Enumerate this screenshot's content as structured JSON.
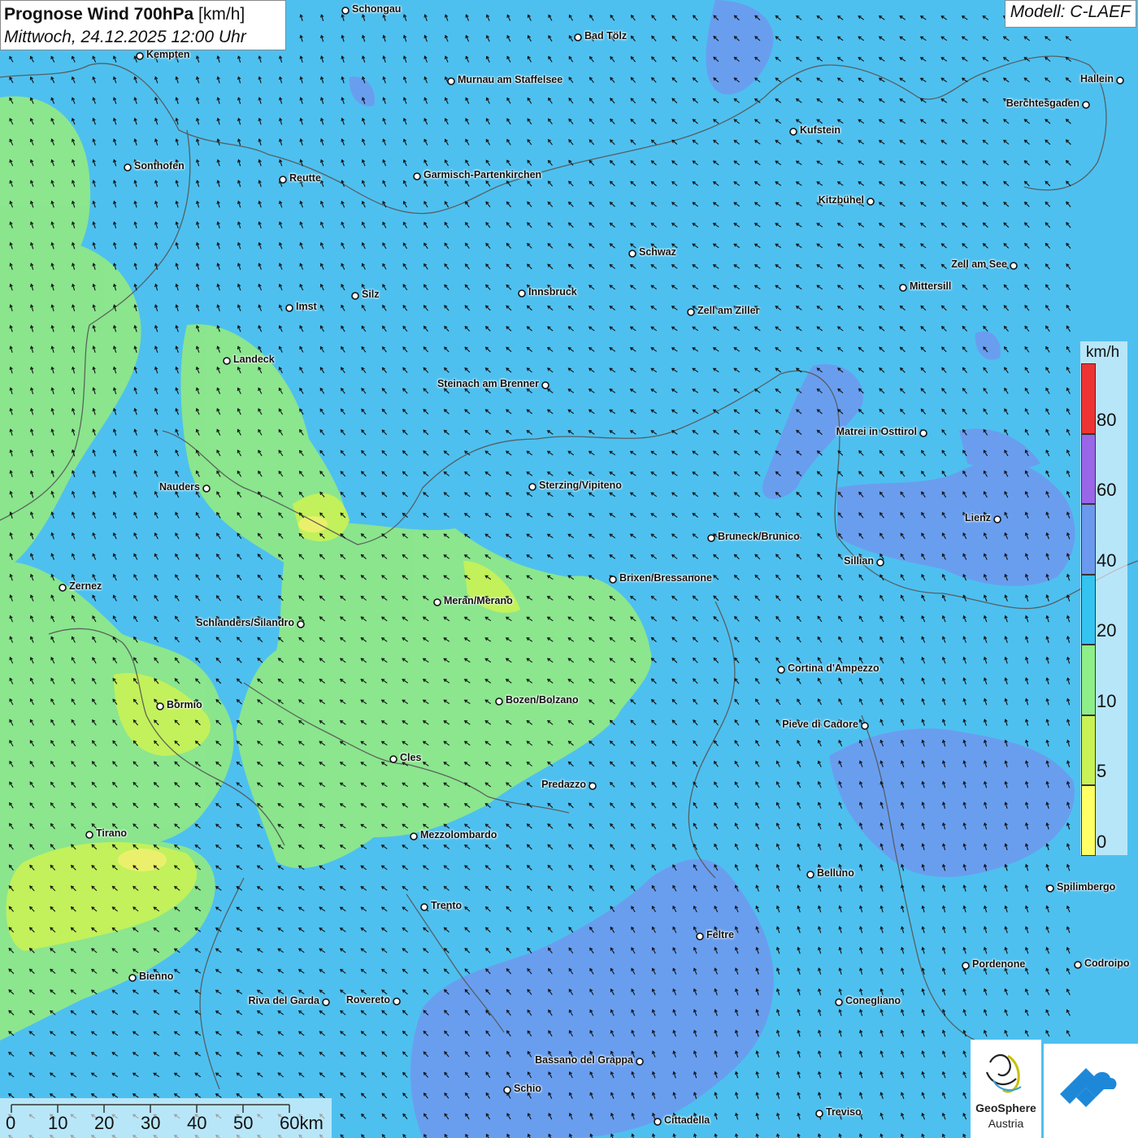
{
  "header": {
    "title_main": "Prognose Wind 700hPa",
    "title_unit": "[km/h]",
    "subtitle": "Mittwoch, 24.12.2025 12:00 Uhr",
    "model": "Modell: C-LAEF"
  },
  "legend": {
    "unit": "km/h",
    "levels": [
      {
        "label": "80",
        "color": "#ee3333"
      },
      {
        "label": "60",
        "color": "#9a66e8"
      },
      {
        "label": "40",
        "color": "#6b99ee"
      },
      {
        "label": "20",
        "color": "#35c3f0"
      },
      {
        "label": "10",
        "color": "#8eee88"
      },
      {
        "label": "5",
        "color": "#c8f255"
      },
      {
        "label": "0",
        "color": "#ffff66"
      }
    ]
  },
  "scalebar": {
    "labels": [
      "0",
      "10",
      "20",
      "30",
      "40",
      "50",
      "60km"
    ]
  },
  "cities": [
    "Schongau",
    "Bad Tölz",
    "Kempten",
    "Murnau am Staffelsee",
    "Hallein",
    "Berchtesgaden",
    "Kufstein",
    "Sonthofen",
    "Reutte",
    "Garmisch-Partenkirchen",
    "Kitzbühel",
    "Schwaz",
    "Zell am See",
    "Mittersill",
    "Innsbruck",
    "Silz",
    "Imst",
    "Zell am Ziller",
    "Landeck",
    "Steinach am Brenner",
    "Matrei in Osttirol",
    "Nauders",
    "Sterzing/Vipiteno",
    "Lienz",
    "Bruneck/Brunico",
    "Sillian",
    "Brixen/Bressanone",
    "Zernez",
    "Meran/Merano",
    "Schlanders/Silandro",
    "Cortina d'Ampezzo",
    "Bozen/Bolzano",
    "Bormio",
    "Pieve di Cadore",
    "Cles",
    "Predazzo",
    "Tirano",
    "Mezzolombardo",
    "Belluno",
    "Spilimbergo",
    "Trento",
    "Feltre",
    "Pordenone",
    "Codroipo",
    "Bienno",
    "Riva del Garda",
    "Rovereto",
    "Conegliano",
    "Bassano del Grappa",
    "Schio",
    "Treviso",
    "Cittadella"
  ],
  "logos": {
    "geosphere_line1": "GeoSphere",
    "geosphere_line2": "Austria"
  },
  "colors": {
    "base_wind": "#4ec0ef",
    "calm_zone": "#8ee888",
    "strong_zone": "#6f98ee",
    "border": "#555555"
  }
}
